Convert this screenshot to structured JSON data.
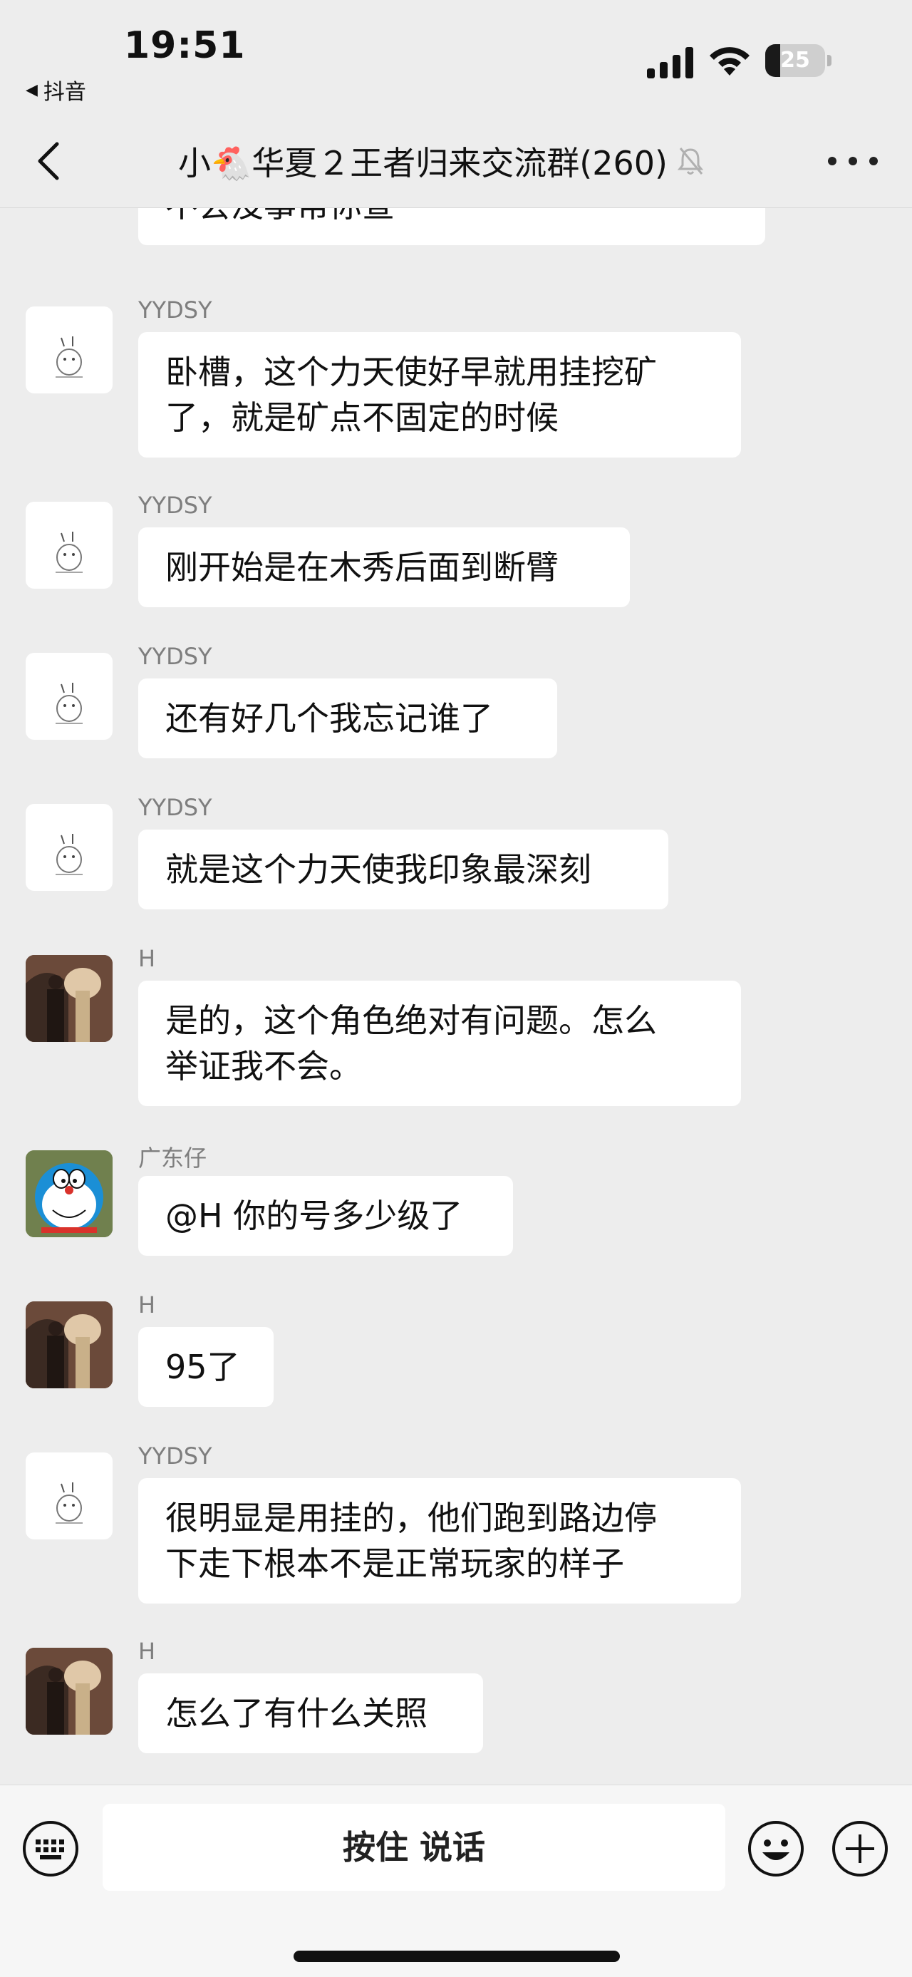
{
  "status_bar": {
    "time": "19:51",
    "back_app": "抖音",
    "battery_level": "25",
    "battery_fraction": 0.25
  },
  "header": {
    "title": "小🐔华夏２王者归来交流群(260)",
    "muted": true
  },
  "messages": [
    {
      "sender": "",
      "avatar": "none",
      "lines": [
        "不会没事帮你查"
      ],
      "partial": true
    },
    {
      "sender": "YYDSY",
      "avatar": "sketch-rabbit",
      "lines": [
        "卧槽，这个力天使好早就用挂挖矿",
        "了，就是矿点不固定的时候"
      ]
    },
    {
      "sender": "YYDSY",
      "avatar": "sketch-rabbit",
      "lines": [
        "刚开始是在木秀后面到断臂"
      ]
    },
    {
      "sender": "YYDSY",
      "avatar": "sketch-rabbit",
      "lines": [
        "还有好几个我忘记谁了"
      ]
    },
    {
      "sender": "YYDSY",
      "avatar": "sketch-rabbit",
      "lines": [
        "就是这个力天使我印象最深刻"
      ]
    },
    {
      "sender": "H",
      "avatar": "photo-person",
      "lines": [
        "是的，这个角色绝对有问题。怎么",
        "举证我不会。"
      ]
    },
    {
      "sender": "广东仔",
      "avatar": "doraemon",
      "lines": [
        "@H 你的号多少级了"
      ]
    },
    {
      "sender": "H",
      "avatar": "photo-person",
      "lines": [
        "95了"
      ]
    },
    {
      "sender": "YYDSY",
      "avatar": "sketch-rabbit",
      "lines": [
        "很明显是用挂的，他们跑到路边停",
        "下走下根本不是正常玩家的样子"
      ]
    },
    {
      "sender": "H",
      "avatar": "photo-person",
      "lines": [
        "怎么了有什么关照"
      ]
    }
  ],
  "input_bar": {
    "hold_to_talk": "按住 说话",
    "icons": [
      "keyboard-icon",
      "emoji-icon",
      "plus-icon"
    ]
  },
  "colors": {
    "background": "#ededed",
    "bubble": "#ffffff",
    "sender_name": "#7e7e7e"
  }
}
